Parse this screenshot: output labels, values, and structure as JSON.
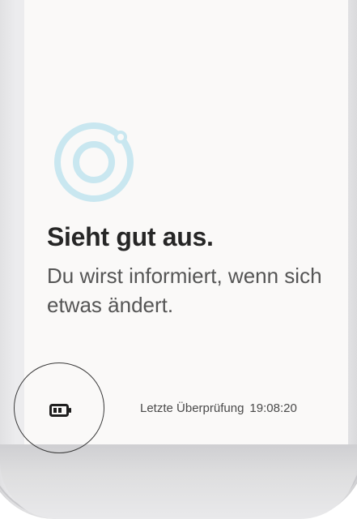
{
  "status": {
    "title": "Sieht gut aus.",
    "description": "Du wirst informiert, wenn sich etwas ändert."
  },
  "footer": {
    "last_check_label": "Letzte Überprüfung",
    "last_check_time": "19:08:20"
  },
  "icons": {
    "status_ring": "status-ring-icon",
    "battery": "battery-icon"
  },
  "colors": {
    "screen_background": "#faf9f8",
    "ring": "#c9e7f0",
    "title_text": "#262626",
    "body_text": "#555555",
    "phone_body": "#ececee"
  }
}
